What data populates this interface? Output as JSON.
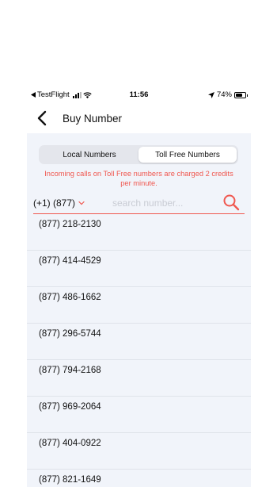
{
  "status_bar": {
    "carrier": "TestFlight",
    "time": "11:56",
    "battery": "74%",
    "battery_level": 0.74
  },
  "nav": {
    "title": "Buy Number"
  },
  "tabs": [
    {
      "label": "Local Numbers",
      "active": false
    },
    {
      "label": "Toll Free Numbers",
      "active": true
    }
  ],
  "notice": "Incoming calls on Toll Free numbers are charged 2 credits per minute.",
  "search": {
    "country_code": "(+1) (877)",
    "placeholder": "search number..."
  },
  "numbers": [
    "(877) 218-2130",
    "(877) 414-4529",
    "(877) 486-1662",
    "(877) 296-5744",
    "(877) 794-2168",
    "(877) 969-2064",
    "(877) 404-0922",
    "(877) 821-1649"
  ],
  "colors": {
    "accent": "#f0574f",
    "content_bg": "#f1f4fa"
  }
}
